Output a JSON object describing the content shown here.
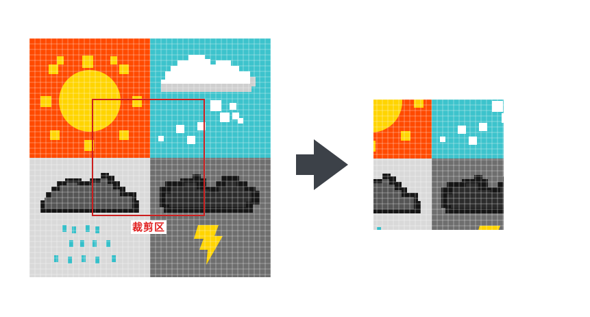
{
  "crop_label": "裁剪区",
  "colors": {
    "sun_bg": "#ff4a00",
    "sun": "#ffd400",
    "snow_bg": "#3dc3cc",
    "cloud_white": "#ffffff",
    "cloud_light_shade": "#cfcfcf",
    "rain_bg": "#d9d9d9",
    "rain_drop": "#35bfc9",
    "storm_bg": "#6e6e6e",
    "cloud_dark": "#555555",
    "cloud_black": "#151515",
    "storm_cloud": "#2c2c2c",
    "lightning": "#ffd400",
    "grid_line": "rgba(255,255,255,0.45)",
    "crop_border": "#cc1e1e",
    "arrow": "#3c4148"
  },
  "tiles": [
    {
      "name": "sunny",
      "icon": "sun-icon"
    },
    {
      "name": "snow",
      "icon": "snow-cloud-icon"
    },
    {
      "name": "rain",
      "icon": "rain-cloud-icon"
    },
    {
      "name": "thunderstorm",
      "icon": "lightning-cloud-icon"
    }
  ]
}
